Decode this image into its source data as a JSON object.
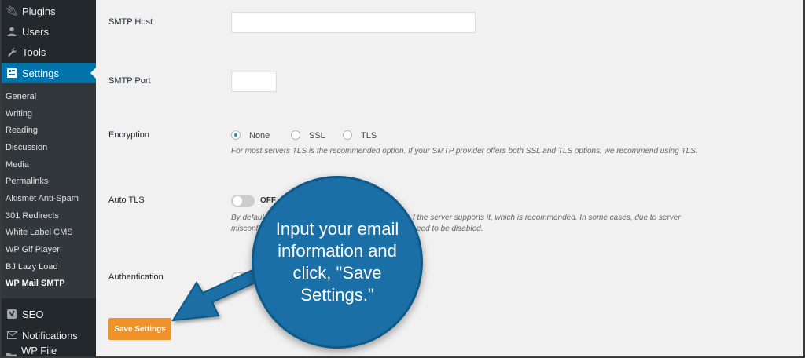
{
  "sidebar": {
    "top_items": [
      {
        "label": "Plugins",
        "icon": "plugin-icon"
      },
      {
        "label": "Users",
        "icon": "user-icon"
      },
      {
        "label": "Tools",
        "icon": "wrench-icon"
      },
      {
        "label": "Settings",
        "icon": "settings-icon",
        "active": true
      }
    ],
    "submenu": [
      "General",
      "Writing",
      "Reading",
      "Discussion",
      "Media",
      "Permalinks",
      "Akismet Anti-Spam",
      "301 Redirects",
      "White Label CMS",
      "WP Gif Player",
      "BJ Lazy Load",
      "WP Mail SMTP"
    ],
    "current_sub": "WP Mail SMTP",
    "bottom_items": [
      {
        "label": "SEO",
        "icon": "seo-icon"
      },
      {
        "label": "Notifications",
        "icon": "mail-icon"
      },
      {
        "label": "WP File Manager",
        "icon": "folder-icon"
      }
    ]
  },
  "form": {
    "smtp_host_label": "SMTP Host",
    "smtp_host_value": "",
    "smtp_port_label": "SMTP Port",
    "smtp_port_value": "",
    "encryption_label": "Encryption",
    "encryption_options": [
      "None",
      "SSL",
      "TLS"
    ],
    "encryption_selected": "None",
    "encryption_desc": "For most servers TLS is the recommended option. If your SMTP provider offers both SSL and TLS options, we recommend using TLS.",
    "auto_tls_label": "Auto TLS",
    "auto_tls_state": "OFF",
    "auto_tls_desc_line1_a": "By defaul",
    "auto_tls_desc_line1_b": "f the server supports it, which is recommended. In some cases, due to server",
    "auto_tls_desc_line2_a": "misconf",
    "auto_tls_desc_line2_b": "eed to be disabled.",
    "authentication_label": "Authentication",
    "save_label": "Save Settings"
  },
  "callout": {
    "text": "Input your email information and click, \"Save Settings.\"",
    "color": "#1a6fa6"
  },
  "colors": {
    "sidebar_bg": "#23282d",
    "active_blue": "#0073aa",
    "save_orange": "#f0922a"
  }
}
